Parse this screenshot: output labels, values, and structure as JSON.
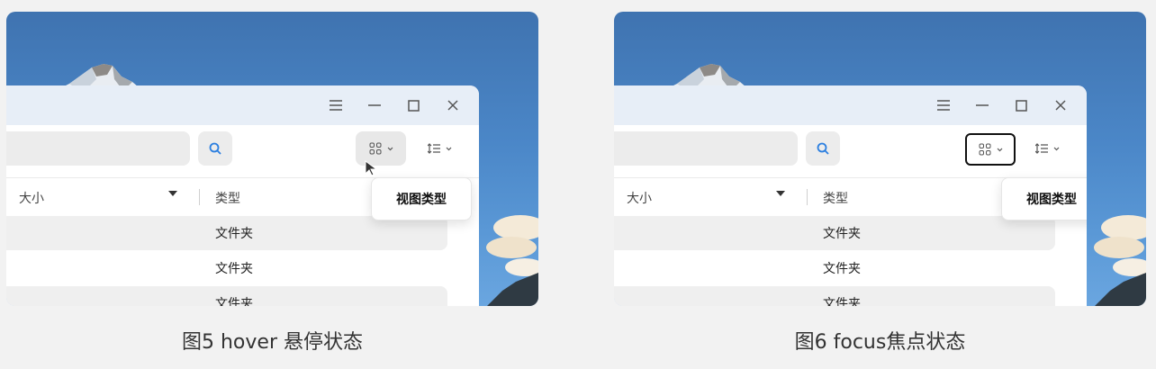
{
  "panels": [
    {
      "titlebar_icons": [
        "menu-icon",
        "minimize-icon",
        "maximize-icon",
        "close-icon"
      ],
      "toolbar": {
        "view_state": "hover"
      },
      "tooltip": "视图类型",
      "columns": {
        "size": "大小",
        "type": "类型"
      },
      "rows": [
        "文件夹",
        "文件夹",
        "文件夹"
      ],
      "caption": "图5 hover 悬停状态"
    },
    {
      "titlebar_icons": [
        "menu-icon",
        "minimize-icon",
        "maximize-icon",
        "close-icon"
      ],
      "toolbar": {
        "view_state": "focus"
      },
      "tooltip": "视图类型",
      "columns": {
        "size": "大小",
        "type": "类型"
      },
      "rows": [
        "文件夹",
        "文件夹",
        "文件夹"
      ],
      "caption": "图6 focus焦点状态"
    }
  ],
  "colors": {
    "background": "#f2f2f2",
    "sky": "#4b87c8",
    "search_icon": "#2b7fe0",
    "focus_ring": "#111111"
  }
}
